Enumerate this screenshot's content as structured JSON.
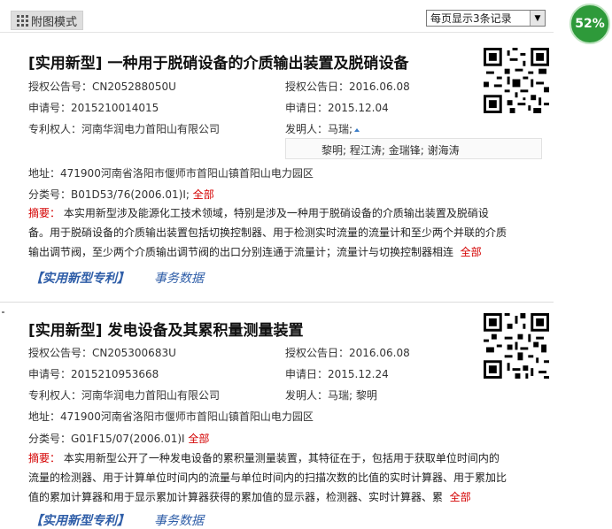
{
  "toolbar": {
    "view_mode_label": "附图模式",
    "page_size_value": "每页显示3条记录",
    "progress_label": "52%"
  },
  "records": [
    {
      "title": "[实用新型] 一种用于脱硝设备的介质输出装置及脱硝设备",
      "pub_no_label": "授权公告号：",
      "pub_no": "CN205288050U",
      "pub_date_label": "授权公告日：",
      "pub_date": "2016.06.08",
      "app_no_label": "申请号：",
      "app_no": "2015210014015",
      "app_date_label": "申请日：",
      "app_date": "2015.12.04",
      "patentee_label": "专利权人：",
      "patentee": "河南华润电力首阳山有限公司",
      "inventor_label": "发明人：",
      "inventor": "马瑞;",
      "inventors_more": "黎明; 程江涛; 金瑞锋; 谢海涛",
      "address_label": "地址：",
      "address": "471900河南省洛阳市偃师市首阳山镇首阳山电力园区",
      "class_label": "分类号：",
      "class_no": "B01D53/76(2006.01)I;",
      "class_all": "全部",
      "abstract_label": "摘要：",
      "abstract_lines": [
        "本实用新型涉及能源化工技术领域，特别是涉及一种用于脱硝设备的介质输出装置及脱硝设",
        "备。用于脱硝设备的介质输出装置包括切换控制器、用于检测实时流量的流量计和至少两个并联的介质",
        "输出调节阀，至少两个介质输出调节阀的出口分别连通于流量计；流量计与切换控制器相连"
      ],
      "abstract_all": "全部",
      "type_link": "【实用新型专利】",
      "business_link": "事务数据"
    },
    {
      "title": "[实用新型] 发电设备及其累积量测量装置",
      "pub_no_label": "授权公告号：",
      "pub_no": "CN205300683U",
      "pub_date_label": "授权公告日：",
      "pub_date": "2016.06.08",
      "app_no_label": "申请号：",
      "app_no": "2015210953668",
      "app_date_label": "申请日：",
      "app_date": "2015.12.24",
      "patentee_label": "专利权人：",
      "patentee": "河南华润电力首阳山有限公司",
      "inventor_label": "发明人：",
      "inventor": "马瑞; 黎明",
      "address_label": "地址：",
      "address": "471900河南省洛阳市偃师市首阳山镇首阳山电力园区",
      "class_label": "分类号：",
      "class_no": "G01F15/07(2006.01)I",
      "class_all": "全部",
      "abstract_label": "摘要：",
      "abstract_lines": [
        "本实用新型公开了一种发电设备的累积量测量装置，其特征在于，包括用于获取单位时间内的",
        "流量的检测器、用于计算单位时间内的流量与单位时间内的扫描次数的比值的实时计算器、用于累加比",
        "值的累加计算器和用于显示累加计算器获得的累加值的显示器，检测器、实时计算器、累"
      ],
      "abstract_all": "全部",
      "type_link": "【实用新型专利】",
      "business_link": "事务数据"
    }
  ]
}
